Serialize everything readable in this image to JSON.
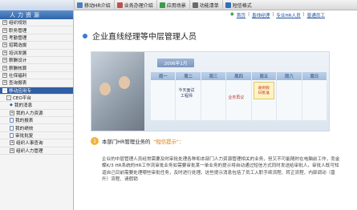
{
  "tabs": [
    {
      "label": "移动HR介绍",
      "icon": "mobile-icon",
      "color": "#4a7fc1"
    },
    {
      "label": "业务办理介绍",
      "icon": "briefcase-icon",
      "color": "#c05050"
    },
    {
      "label": "应用场景",
      "icon": "scene-icon",
      "color": "#3c9a4a"
    },
    {
      "label": "功能清单",
      "icon": "list-icon",
      "color": "#6b6b6b"
    },
    {
      "label": "短信格式",
      "icon": "sms-icon",
      "color": "#2f6fbf"
    }
  ],
  "sidebar": {
    "title": "人力资源",
    "items": [
      {
        "label": "组织规划",
        "toggle": "+"
      },
      {
        "label": "职务管理",
        "toggle": "+"
      },
      {
        "label": "考勤管理",
        "toggle": "+"
      },
      {
        "label": "招聘选拔",
        "toggle": "+"
      },
      {
        "label": "培训发展",
        "toggle": "+"
      },
      {
        "label": "薪酬设计",
        "toggle": "+"
      },
      {
        "label": "薪酬核算",
        "toggle": "+"
      },
      {
        "label": "社保福利",
        "toggle": "+"
      },
      {
        "label": "查询报表",
        "toggle": "+"
      },
      {
        "label": "移动应用专",
        "toggle": "-"
      },
      {
        "label": "CEO平台",
        "toggle": "-"
      },
      {
        "label": "我的消息",
        "toggle": ""
      },
      {
        "label": "我的人力资源",
        "toggle": "+"
      },
      {
        "label": "我的报表",
        "toggle": ""
      },
      {
        "label": "我的绩效",
        "toggle": ""
      },
      {
        "label": "审批批复",
        "toggle": ""
      },
      {
        "label": "组织人事查询",
        "toggle": "+"
      },
      {
        "label": "组织人力管理",
        "toggle": "+"
      }
    ]
  },
  "breadcrumb": [
    "首页",
    "直线经理",
    "专业HR人员",
    "普通员工"
  ],
  "page_title": "企业直线经理等中层管理人员",
  "calendar": {
    "year_label": "2006年1月",
    "days": [
      "周一",
      "周二",
      "周三",
      "周四",
      "周五",
      "周六",
      "周日"
    ],
    "events": {
      "tue": "今天面试\n工程师",
      "wed": "",
      "thu": "业务再议",
      "fri_box": "收到假\n日批准"
    }
  },
  "section": {
    "number": "1",
    "title": "本部门HR管理业务的",
    "highlight": "\"短信提示\"："
  },
  "paragraph": "企业的中层管理人员经常需要及时审批处理各种和本部门人力资源管理相关的业务，但又不可能随时在电脑前工作，而金蝶K/3 HR系统的HR工作流审批业务如需要审批某一单业务的提示将自动通过短信方式同时发送给审批人，审批人既可知道自己目前需要处理哪些审批任务，及时进行处理。这些提示消息包括了员工入职手续流程、转正流程、内部调动（晋升）流程、请假销"
}
